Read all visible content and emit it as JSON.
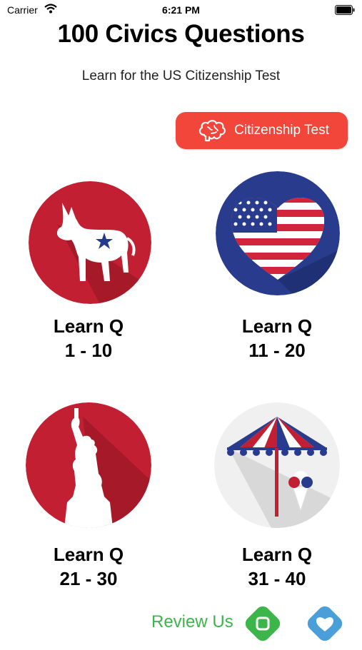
{
  "status_bar": {
    "carrier": "Carrier",
    "time": "6:21 PM"
  },
  "header": {
    "title": "100 Civics Questions",
    "subtitle": "Learn for the US Citizenship Test"
  },
  "citizenship_button": {
    "label": "Citizenship Test",
    "color": "#f2463a"
  },
  "tiles": [
    {
      "icon": "donkey-icon",
      "line1": "Learn Q",
      "line2": "1 - 10"
    },
    {
      "icon": "flag-heart-icon",
      "line1": "Learn Q",
      "line2": "11 - 20"
    },
    {
      "icon": "statue-of-liberty-icon",
      "line1": "Learn Q",
      "line2": "21 - 30"
    },
    {
      "icon": "umbrella-ice-cream-icon",
      "line1": "Learn Q",
      "line2": "31 - 40"
    }
  ],
  "footer": {
    "review_label": "Review Us",
    "review_color": "#3cb54a",
    "favorite_color": "#4a9fd8"
  }
}
